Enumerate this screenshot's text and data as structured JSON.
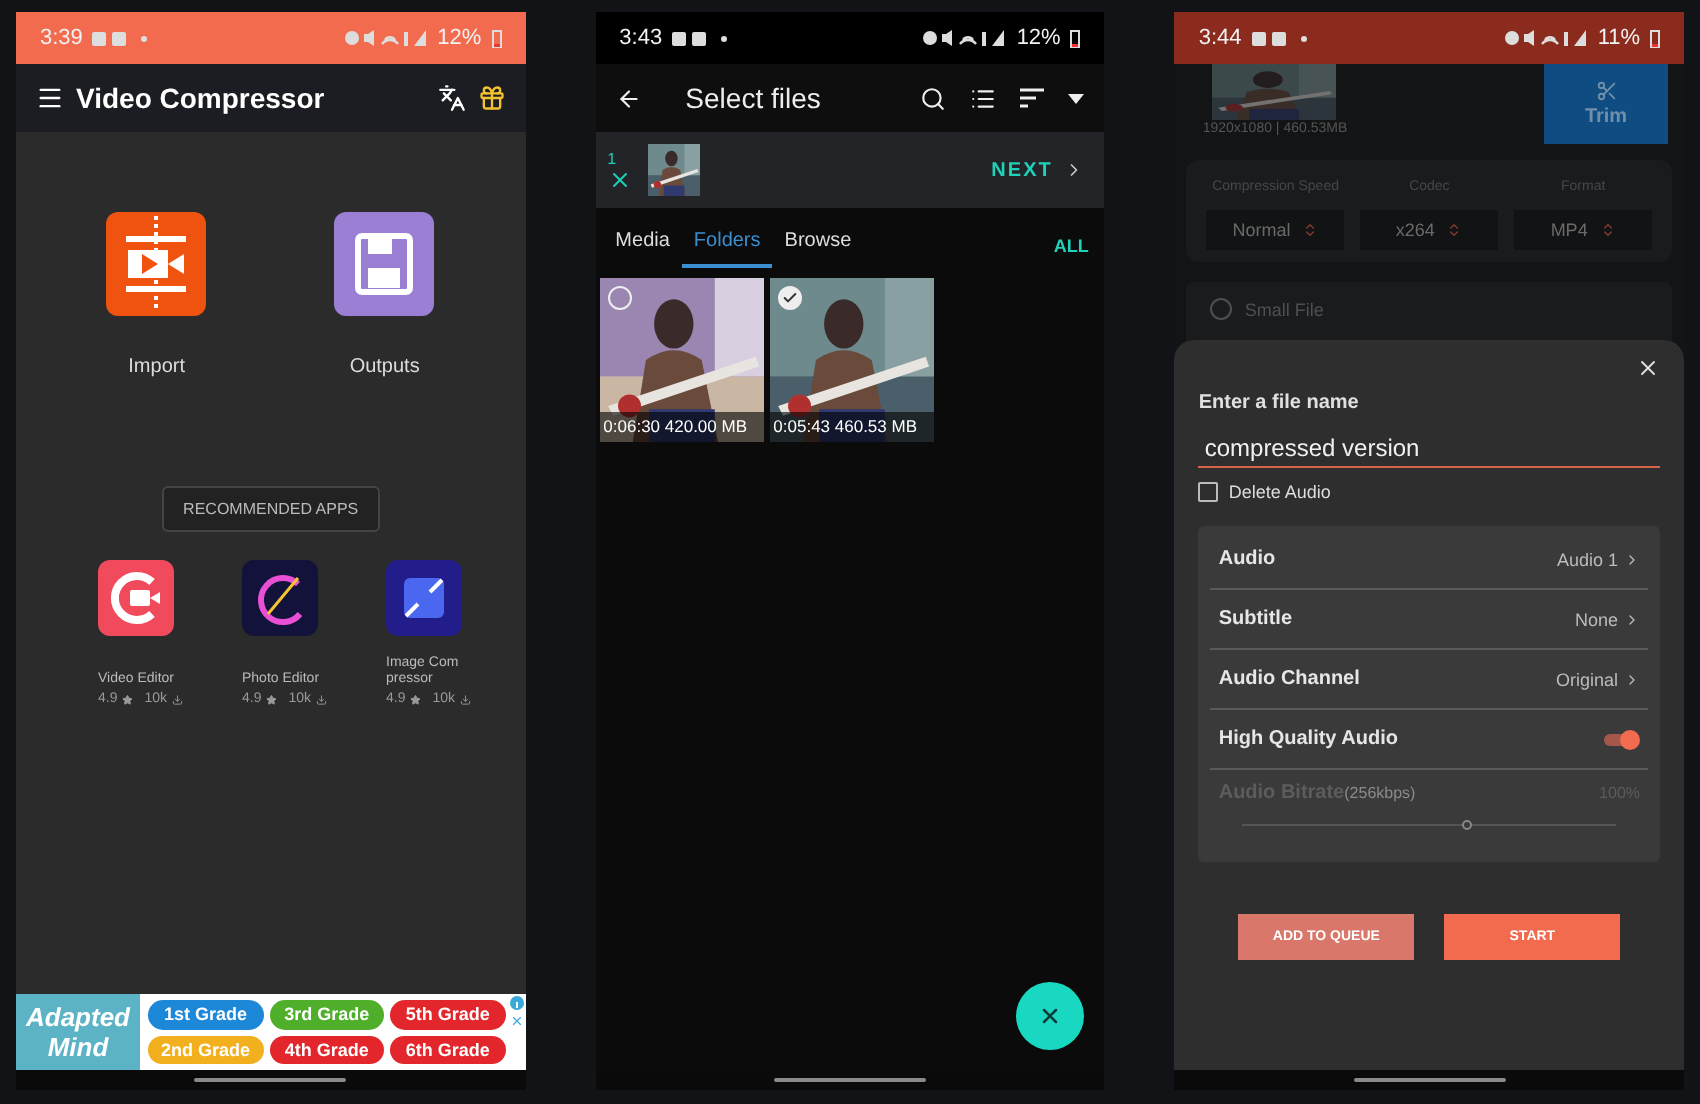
{
  "home_screen": {
    "status_bar": {
      "time": "3:39",
      "battery": "12%",
      "color": "#f26b4f"
    },
    "app_bar": {
      "title": "Video Compressor"
    },
    "actions": [
      {
        "label": "Import",
        "kind": "import"
      },
      {
        "label": "Outputs",
        "kind": "outputs"
      }
    ],
    "recommended": {
      "title": "RECOMMENDED APPS",
      "apps": [
        {
          "name": "Video Editor",
          "rating": "4.9",
          "installs": "10k",
          "kind": "video"
        },
        {
          "name": "Photo Editor",
          "rating": "4.9",
          "installs": "10k"
        },
        {
          "name": "Image Com pressor",
          "rating": "4.9",
          "installs": "10k"
        }
      ]
    },
    "ad": {
      "brand": "Adapted Mind",
      "grades": [
        {
          "label": "1st Grade",
          "color": "#1e88d8"
        },
        {
          "label": "3rd Grade",
          "color": "#4fae2a"
        },
        {
          "label": "5th Grade",
          "color": "#e3262b"
        },
        {
          "label": "2nd Grade",
          "color": "#f2b01e"
        },
        {
          "label": "4th Grade",
          "color": "#e3262b"
        },
        {
          "label": "6th Grade",
          "color": "#e3262b"
        }
      ]
    }
  },
  "select_files_screen": {
    "status_bar": {
      "time": "3:43",
      "battery": "12%",
      "color": "#000000"
    },
    "toolbar": {
      "title": "Select files"
    },
    "selection": {
      "count": "1",
      "next": "NEXT"
    },
    "tabs": [
      {
        "label": "Media",
        "selected": false
      },
      {
        "label": "Folders",
        "selected": true
      },
      {
        "label": "Browse",
        "selected": false
      }
    ],
    "all_link": "ALL",
    "videos": [
      {
        "duration": "0:06:30",
        "size": "420.00 MB",
        "selected": false
      },
      {
        "duration": "0:05:43",
        "size": "460.53 MB",
        "selected": true
      }
    ]
  },
  "compress_screen": {
    "status_bar": {
      "time": "3:44",
      "battery": "11%",
      "color": "#8b2b1d"
    },
    "video_info": "1920x1080 | 460.53MB",
    "trim": "Trim",
    "options": [
      {
        "label": "Compression Speed",
        "value": "Normal"
      },
      {
        "label": "Codec",
        "value": "x264"
      },
      {
        "label": "Format",
        "value": "MP4"
      }
    ],
    "preset": {
      "label": "Small File",
      "selected": false
    },
    "dialog": {
      "heading": "Enter a file name",
      "file_name": "compressed version",
      "delete_audio": {
        "label": "Delete Audio",
        "checked": false
      },
      "settings": [
        {
          "kind": "link",
          "label": "Audio",
          "value": "Audio 1"
        },
        {
          "kind": "link",
          "label": "Subtitle",
          "value": "None"
        },
        {
          "kind": "link",
          "label": "Audio Channel",
          "value": "Original"
        },
        {
          "kind": "toggle",
          "label": "High Quality Audio",
          "on": true
        },
        {
          "kind": "slider",
          "label": "Audio Bitrate",
          "suffix": "(256kbps)",
          "value": "100%",
          "disabled": true,
          "level": 0.6
        }
      ],
      "buttons": [
        {
          "label": "ADD TO QUEUE",
          "kind": "secondary"
        },
        {
          "label": "START",
          "kind": "primary"
        }
      ]
    }
  }
}
